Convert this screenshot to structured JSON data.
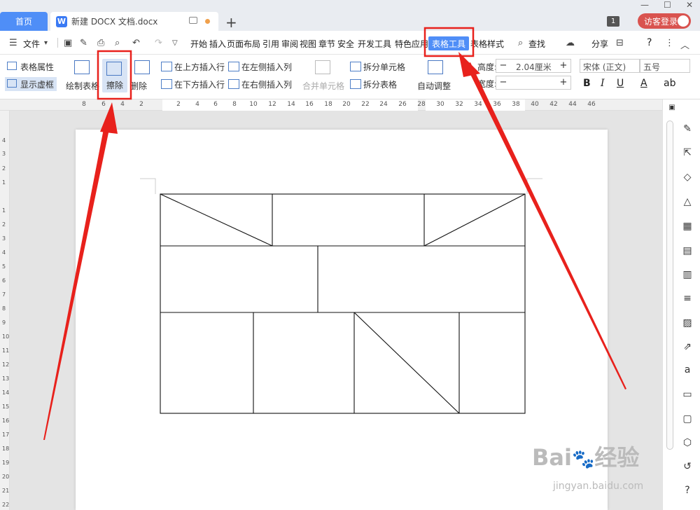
{
  "tabs": {
    "home": "首页",
    "document": "新建 DOCX 文档.docx",
    "badge": "1",
    "login": "访客登录"
  },
  "menu": {
    "file": "文件",
    "items": [
      "开始",
      "插入",
      "页面布局",
      "引用",
      "审阅",
      "视图",
      "章节",
      "安全",
      "开发工具",
      "特色应用",
      "表格工具",
      "表格样式"
    ],
    "search": "查找",
    "share": "分享",
    "help": "?"
  },
  "ribbon": {
    "table_props": "表格属性",
    "show_grid": "显示虚框",
    "draw_table": "绘制表格",
    "erase": "擦除",
    "delete": "删除",
    "insert_above": "在上方插入行",
    "insert_below": "在下方插入行",
    "insert_left": "在左侧插入列",
    "insert_right": "在右侧插入列",
    "merge_cells": "合并单元格",
    "split_cells": "拆分单元格",
    "split_table": "拆分表格",
    "auto_fit": "自动调整",
    "height_label": "高度:",
    "height_value": "2.04厘米",
    "width_label": "宽度:",
    "width_value": "",
    "font_name": "宋体 (正文)",
    "font_size": "五号",
    "bold": "B",
    "italic": "I",
    "underline": "U",
    "font_color": "A",
    "char_style": "ab"
  },
  "ruler": {
    "h_ticks": [
      "8",
      "6",
      "4",
      "2",
      "2",
      "4",
      "6",
      "8",
      "10",
      "12",
      "14",
      "16",
      "18",
      "20",
      "22",
      "24",
      "26",
      "28",
      "30",
      "32",
      "34",
      "36",
      "38",
      "40",
      "42",
      "44",
      "46"
    ],
    "v_ticks": [
      "4",
      "3",
      "2",
      "1",
      "1",
      "2",
      "3",
      "4",
      "5",
      "6",
      "7",
      "8",
      "9",
      "10",
      "11",
      "12",
      "13",
      "14",
      "15",
      "16",
      "17",
      "18",
      "19",
      "20",
      "21",
      "22"
    ]
  },
  "watermark": {
    "brand": "Bai",
    "brand2": "经验",
    "url": "jingyan.baidu.com"
  },
  "colors": {
    "accent": "#4f8ef7",
    "highlight_red": "#e8211c",
    "login_bg": "#d9534f"
  }
}
